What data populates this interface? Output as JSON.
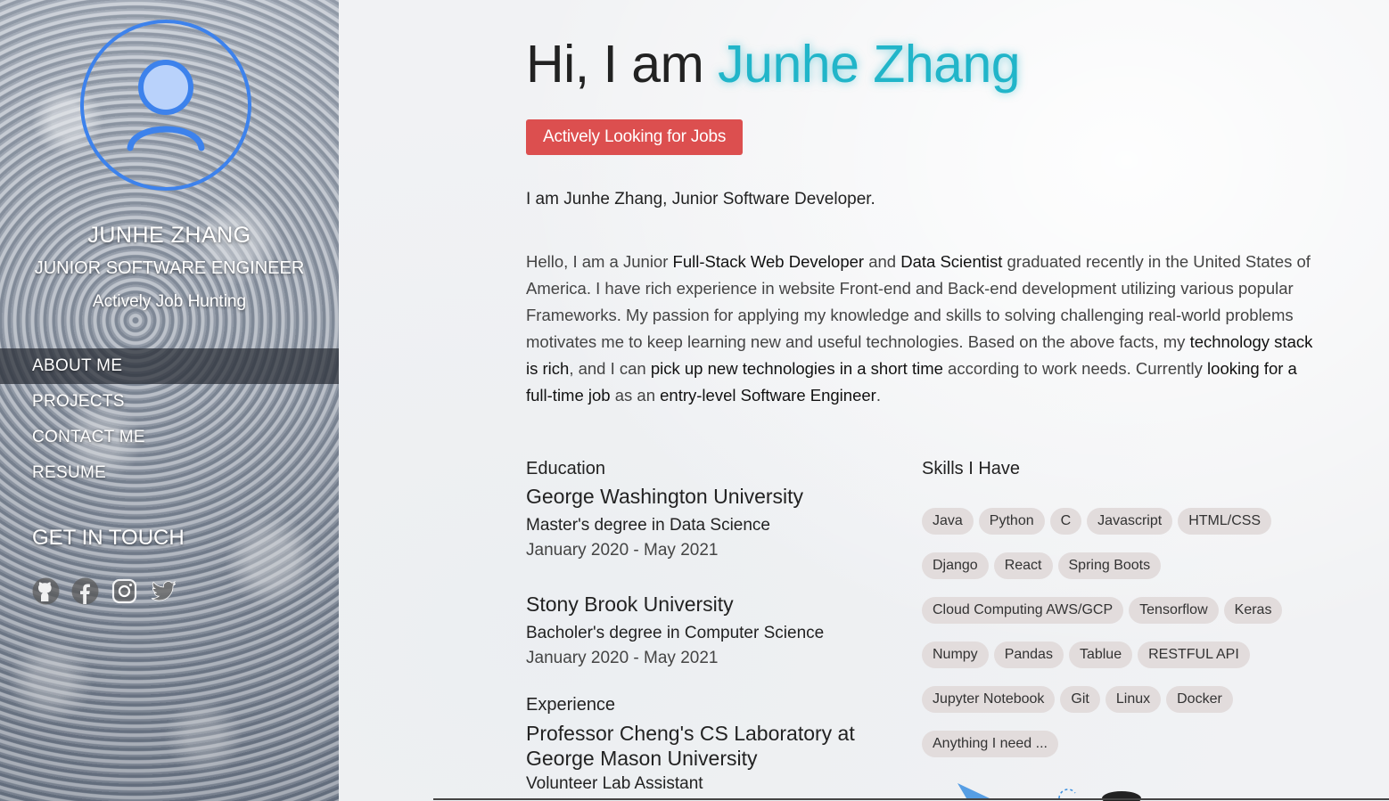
{
  "profile": {
    "name": "JUNHE ZHANG",
    "title": "JUNIOR SOFTWARE ENGINEER",
    "status": "Actively Job Hunting"
  },
  "nav": {
    "items": [
      {
        "label": "ABOUT ME",
        "active": true
      },
      {
        "label": "PROJECTS",
        "active": false
      },
      {
        "label": "CONTACT ME",
        "active": false
      },
      {
        "label": "RESUME",
        "active": false
      }
    ]
  },
  "contact": {
    "title": "GET IN TOUCH",
    "icons": [
      "github-icon",
      "facebook-icon",
      "instagram-icon",
      "twitter-icon"
    ]
  },
  "hero": {
    "prefix": "Hi, I am ",
    "name": "Junhe Zhang",
    "badge": "Actively Looking for Jobs",
    "accent_color": "#21b5c9",
    "badge_color": "#dc4f4f"
  },
  "intro": "I am Junhe Zhang, Junior Software Developer.",
  "bio": [
    {
      "t": "Hello, I am a Junior ",
      "b": false
    },
    {
      "t": "Full-Stack Web Developer",
      "b": true
    },
    {
      "t": " and ",
      "b": false
    },
    {
      "t": "Data Scientist",
      "b": true
    },
    {
      "t": " graduated recently in the United States of America. I have rich experience in website Front-end and Back-end development utilizing various popular Frameworks. My passion for applying my knowledge and skills to solving challenging real-world problems motivates me to keep learning new and useful technologies. Based on the above facts, my ",
      "b": false
    },
    {
      "t": "technology stack is rich",
      "b": true
    },
    {
      "t": ", and I can ",
      "b": false
    },
    {
      "t": "pick up new technologies in a short time",
      "b": true
    },
    {
      "t": " according to work needs. Currently ",
      "b": false
    },
    {
      "t": "looking for a full-time job",
      "b": true
    },
    {
      "t": " as an ",
      "b": false
    },
    {
      "t": "entry-level Software Engineer",
      "b": true
    },
    {
      "t": ".",
      "b": false
    }
  ],
  "education": {
    "label": "Education",
    "items": [
      {
        "school": "George Washington University",
        "degree": "Master's degree in Data Science",
        "dates": "January 2020 - May 2021"
      },
      {
        "school": "Stony Brook University",
        "degree": "Bacholer's degree in Computer Science",
        "dates": "January 2020 - May 2021"
      }
    ]
  },
  "experience": {
    "label": "Experience",
    "org_line1": "Professor Cheng's CS Laboratory at",
    "org_line2": "George Mason University",
    "role": "Volunteer Lab Assistant"
  },
  "skills": {
    "label": "Skills I Have",
    "items": [
      "Java",
      "Python",
      "C",
      "Javascript",
      "HTML/CSS",
      "Django",
      "React",
      "Spring Boots",
      "Cloud Computing AWS/GCP",
      "Tensorflow",
      "Keras",
      "Numpy",
      "Pandas",
      "Tablue",
      "RESTFUL API",
      "Jupyter Notebook",
      "Git",
      "Linux",
      "Docker",
      "Anything I need ..."
    ]
  }
}
